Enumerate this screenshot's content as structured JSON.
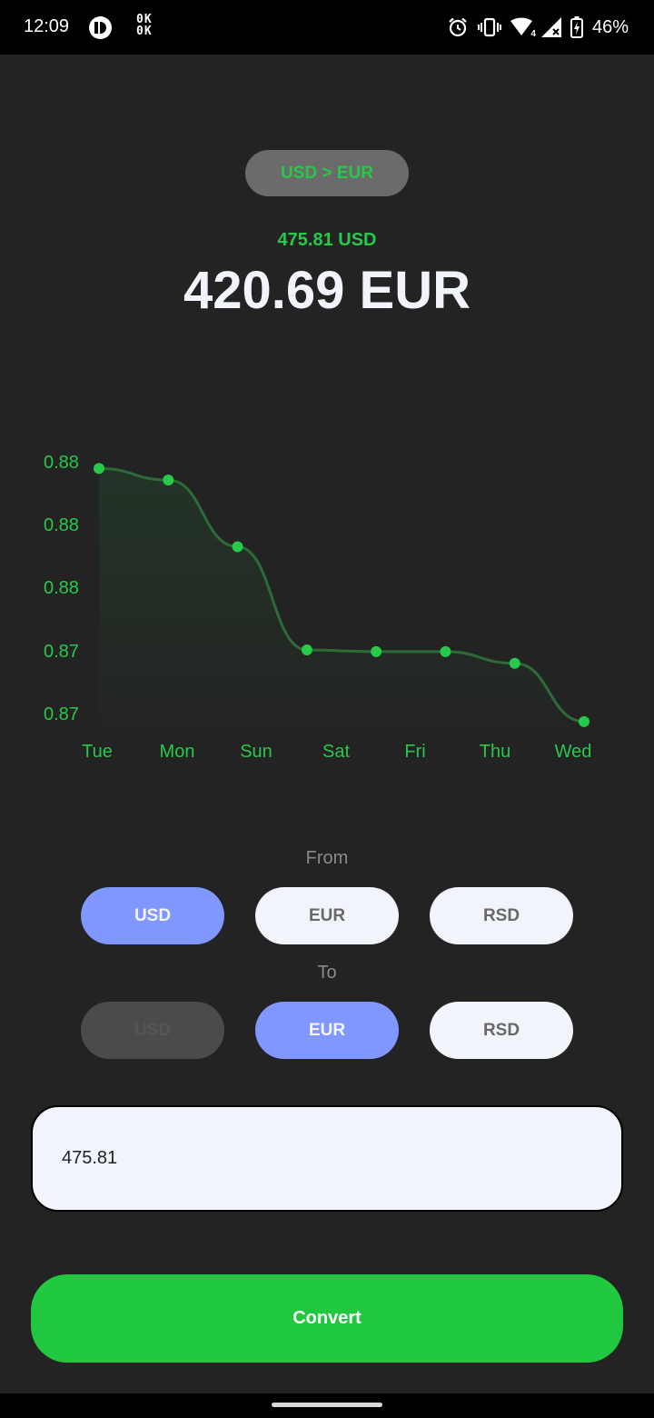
{
  "status_bar": {
    "time": "12:09",
    "okok_line1": "0K",
    "okok_line2": "0K",
    "battery": "46%",
    "network_badge": "4"
  },
  "header": {
    "pair": "USD > EUR",
    "from_amount": "475.81 USD",
    "result": "420.69 EUR"
  },
  "chart_data": {
    "type": "line",
    "categories": [
      "Tue",
      "Mon",
      "Sun",
      "Sat",
      "Fri",
      "Thu",
      "Wed"
    ],
    "values": [
      0.8811,
      0.8804,
      0.8764,
      0.8702,
      0.8701,
      0.8701,
      0.8694,
      0.8659
    ],
    "y_tick_labels": [
      "0.88",
      "0.88",
      "0.88",
      "0.87",
      "0.87"
    ],
    "ylim": [
      0.866,
      0.8815
    ],
    "grid": false,
    "colors": {
      "line": "#2e6b38",
      "point": "#27c94a",
      "label": "#27c94a"
    }
  },
  "from_section": {
    "label": "From",
    "options": [
      "USD",
      "EUR",
      "RSD"
    ],
    "selected": "USD"
  },
  "to_section": {
    "label": "To",
    "options": [
      "USD",
      "EUR",
      "RSD"
    ],
    "selected": "EUR",
    "disabled": "USD"
  },
  "amount_input": {
    "value": "475.81"
  },
  "convert_button": {
    "label": "Convert"
  },
  "colors": {
    "accent_green": "#20c840",
    "selected_blue": "#7f97ff",
    "background": "#232323"
  }
}
